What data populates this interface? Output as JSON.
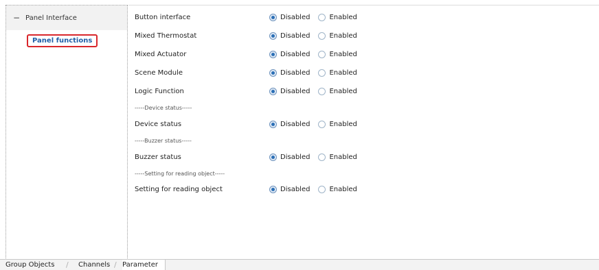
{
  "tree": {
    "root": {
      "toggle": "−",
      "label": "Panel Interface"
    },
    "child": {
      "label": "Panel functions"
    }
  },
  "options": {
    "disabled": "Disabled",
    "enabled": "Enabled"
  },
  "params": [
    {
      "label": "Button interface",
      "selected": "disabled"
    },
    {
      "label": "Mixed Thermostat",
      "selected": "disabled"
    },
    {
      "label": "Mixed Actuator",
      "selected": "disabled"
    },
    {
      "label": "Scene Module",
      "selected": "disabled"
    },
    {
      "label": "Logic Function",
      "selected": "disabled"
    },
    {
      "label": "Device status",
      "selected": "disabled"
    },
    {
      "label": "Buzzer status",
      "selected": "disabled"
    },
    {
      "label": "Setting for reading object",
      "selected": "disabled"
    }
  ],
  "separators": [
    "-----Device status-----",
    "-----Buzzer  status-----",
    "-----Setting for reading object-----"
  ],
  "tabs": [
    {
      "label": "Group Objects"
    },
    {
      "label": "Channels"
    },
    {
      "label": "Parameter",
      "active": true
    }
  ]
}
